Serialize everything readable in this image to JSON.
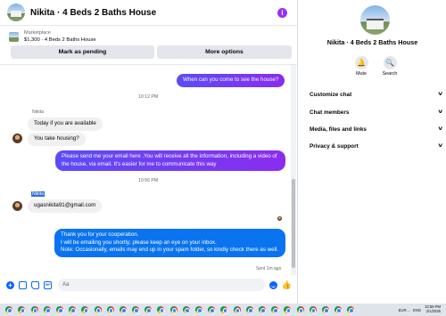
{
  "chat": {
    "title": "Nikita · 4 Beds 2 Baths House",
    "marketplace_label": "Marketplace",
    "listing": "$1,300 · 4 Beds 2 Baths House",
    "buttons": {
      "mark_pending": "Mark as pending",
      "more_options": "More options"
    },
    "messages": {
      "m1": "When can you come to see the house?",
      "ts1": "10:12 PM",
      "sender1": "Nikita",
      "m2": "Today if you are available",
      "m3": "You take housing?",
      "m4": "Please send me your email here .You will receive all the information, including a video of the house, via email. It's easier for me to communicate this way",
      "ts2": "10:56 PM",
      "sender2": "Nikita",
      "m5": "ugasnikita91@gmail.com",
      "m6": "Thank you for your cooperation.\nI will be emailing you shortly; please keep an eye on your inbox.\nNote: Occasionally, emails may end up in your spam folder, so kindly check there as well.",
      "status": "Sent 1m ago"
    },
    "composer_placeholder": "Aa"
  },
  "info": {
    "name": "Nikita · 4 Beds 2 Baths House",
    "mute_label": "Mute",
    "search_label": "Search",
    "sections": [
      "Customize chat",
      "Chat members",
      "Media, files and links",
      "Privacy & support"
    ]
  },
  "taskbar": {
    "app_count": 28,
    "currency": "EUR...",
    "lang": "ENG",
    "time": "10:58 PM",
    "date": "2/1/2025"
  },
  "colors": {
    "accent": "#0866ff",
    "outgoing_gradient": [
      "#5b4cf7",
      "#8a2cf0"
    ],
    "info_icon": "#9b2ff2"
  }
}
